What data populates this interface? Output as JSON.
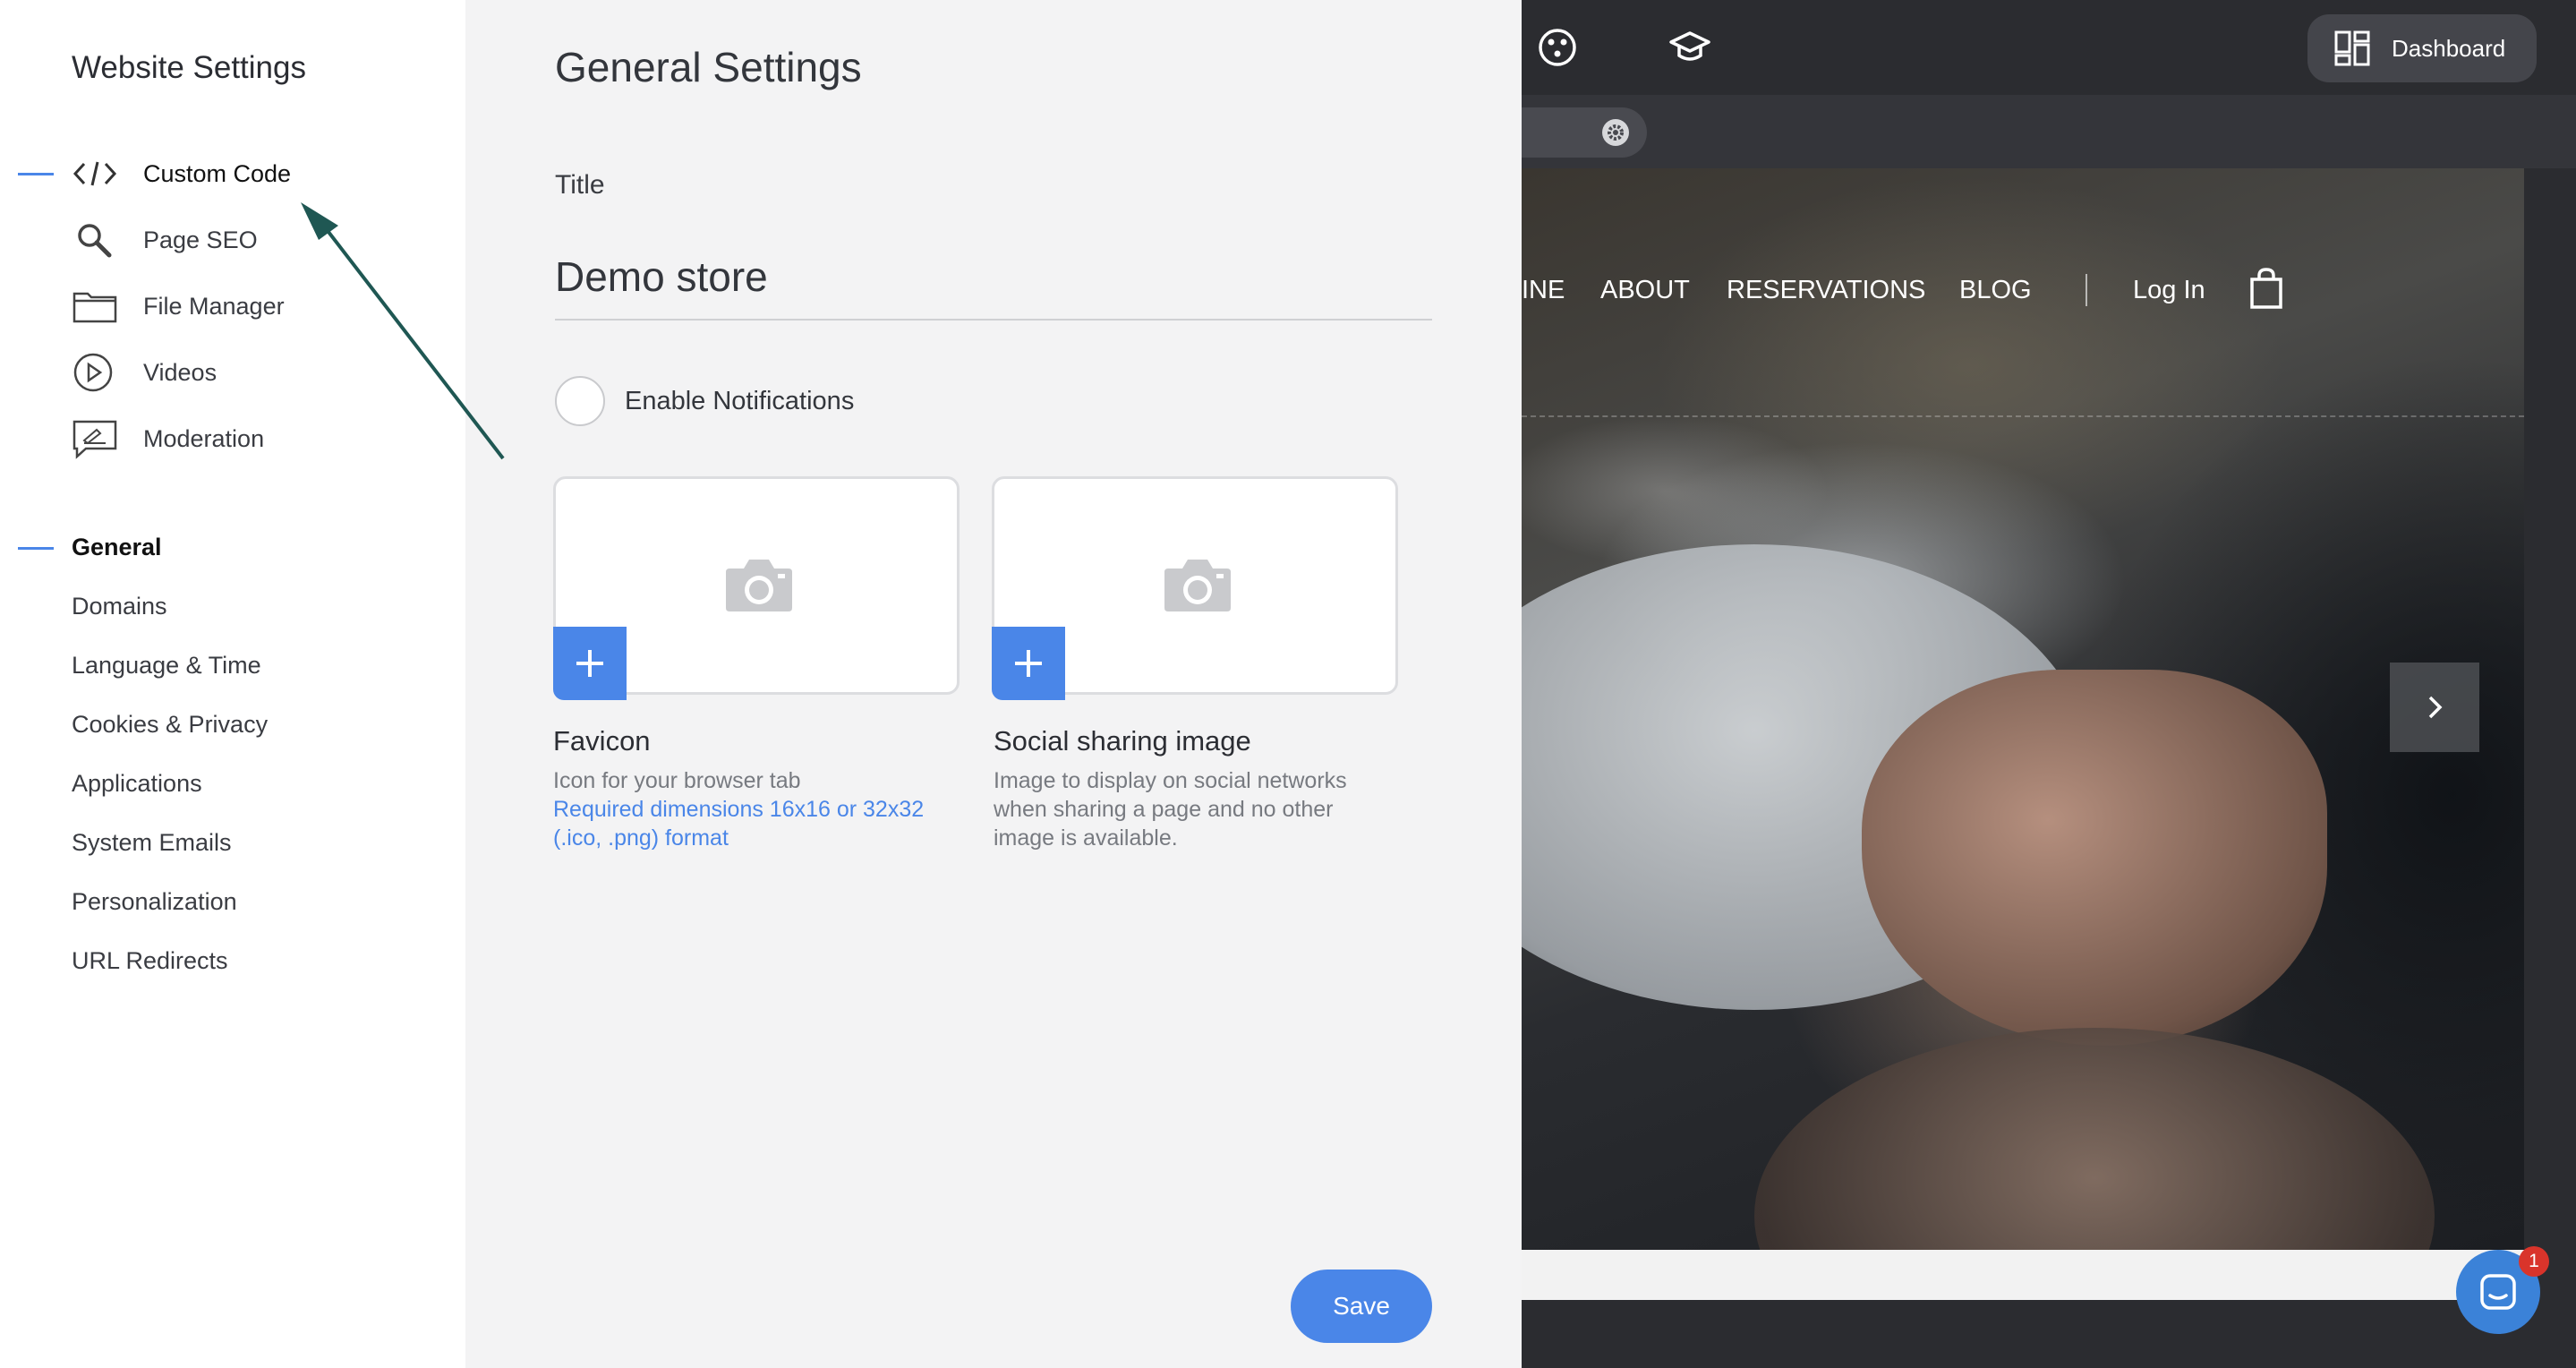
{
  "sidebar": {
    "title": "Website Settings",
    "tools": [
      {
        "label": "Custom Code",
        "icon": "code-icon"
      },
      {
        "label": "Page SEO",
        "icon": "search-icon"
      },
      {
        "label": "File Manager",
        "icon": "folder-icon"
      },
      {
        "label": "Videos",
        "icon": "play-icon"
      },
      {
        "label": "Moderation",
        "icon": "moderation-icon"
      }
    ],
    "general": [
      {
        "label": "General"
      },
      {
        "label": "Domains"
      },
      {
        "label": "Language & Time"
      },
      {
        "label": "Cookies & Privacy"
      },
      {
        "label": "Applications"
      },
      {
        "label": "System Emails"
      },
      {
        "label": "Personalization"
      },
      {
        "label": "URL Redirects"
      }
    ]
  },
  "panel": {
    "heading": "General Settings",
    "title_label": "Title",
    "title_value": "Demo store",
    "notifications_label": "Enable Notifications",
    "favicon": {
      "title": "Favicon",
      "desc": "Icon for your browser tab",
      "requirement": "Required dimensions 16x16 or 32x32 (.ico, .png) format"
    },
    "social": {
      "title": "Social sharing image",
      "desc": "Image to display on social networks when sharing a page and no other image is available."
    },
    "save_label": "Save"
  },
  "preview": {
    "dashboard_label": "Dashboard",
    "nav": [
      "INE",
      "ABOUT",
      "RESERVATIONS",
      "BLOG"
    ],
    "login_label": "Log In",
    "chat_badge": "1"
  },
  "colors": {
    "accent": "#4a86e8",
    "annotation_arrow": "#1f5753",
    "badge": "#d9342b"
  }
}
